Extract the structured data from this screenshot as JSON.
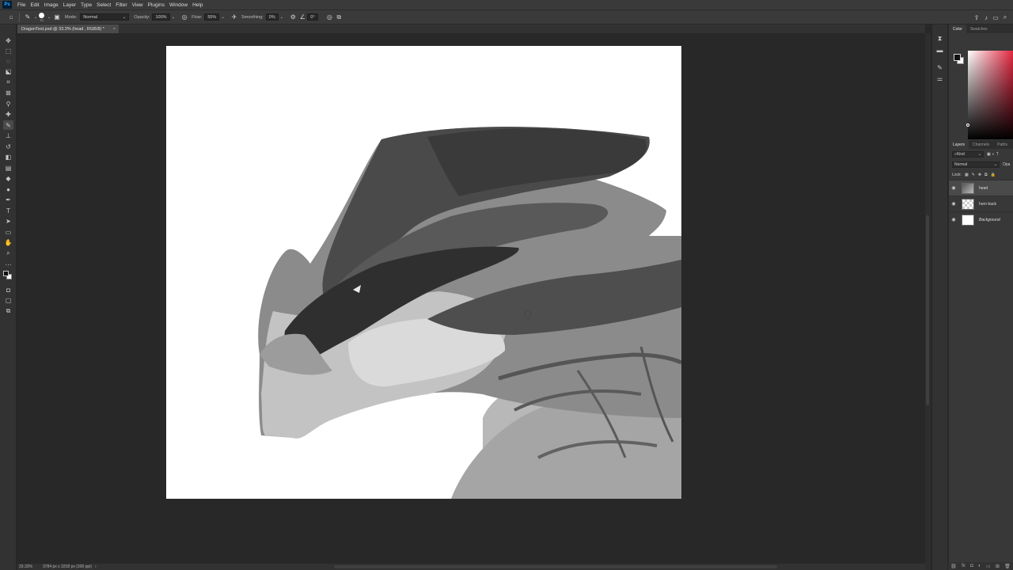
{
  "app": {
    "logo": "Ps"
  },
  "menu": [
    "File",
    "Edit",
    "Image",
    "Layer",
    "Type",
    "Select",
    "Filter",
    "View",
    "Plugins",
    "Window",
    "Help"
  ],
  "options": {
    "mode_label": "Mode:",
    "mode_value": "Normal",
    "opacity_label": "Opacity:",
    "opacity_value": "100%",
    "flow_label": "Flow:",
    "flow_value": "55%",
    "smoothing_label": "Smoothing:",
    "smoothing_value": "0%",
    "angle_value": "0°",
    "brush_size": "70"
  },
  "document": {
    "tab_title": "DragonTest.psd @ 33.3% (head , RGB/8) *",
    "close": "×"
  },
  "status": {
    "zoom": "33.33%",
    "dimensions": "3784 px x 3318 px (300 ppi)"
  },
  "panels": {
    "color_tabs": [
      "Color",
      "Swatches"
    ],
    "layer_tabs": [
      "Layers",
      "Channels",
      "Paths"
    ],
    "kind_filter": "Kind",
    "blend_mode": "Normal",
    "opacity_abbrev": "Opa",
    "lock_label": "Lock:",
    "layers": [
      {
        "name": "head",
        "visible": true,
        "selected": true
      },
      {
        "name": "horn back",
        "visible": true,
        "selected": false
      },
      {
        "name": "Background",
        "visible": true,
        "selected": false
      }
    ]
  },
  "colors": {
    "foreground": "#111111",
    "background": "#ffffff",
    "picker_hue": "#e4243f",
    "ui_bg": "#282828"
  }
}
